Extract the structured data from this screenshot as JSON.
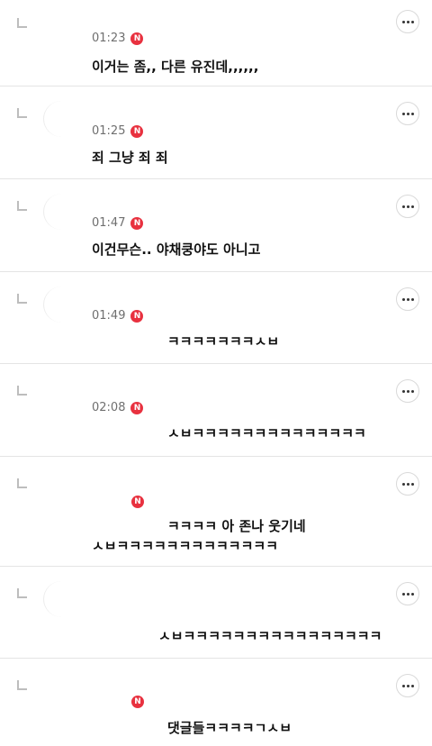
{
  "comments": [
    {
      "time": "01:23",
      "badge": "N",
      "text": "이거는 좀,, 다른 유진데,,,,,,"
    },
    {
      "time": "01:25",
      "badge": "N",
      "text": "죄 그냥 죄 죄"
    },
    {
      "time": "01:47",
      "badge": "N",
      "text": "이건무슨.. 야채쿵야도 아니고"
    },
    {
      "time": "01:49",
      "badge": "N",
      "text": "ㅋㅋㅋㅋㅋㅋㅋㅅㅂ"
    },
    {
      "time": "02:08",
      "badge": "N",
      "text": "ㅅㅂㅋㅋㅋㅋㅋㅋㅋㅋㅋㅋㅋㅋㅋㅋ"
    },
    {
      "time": "",
      "badge": "N",
      "text": "ㅋㅋㅋㅋ 아 존나 웃기네",
      "text2": "ㅅㅂㅋㅋㅋㅋㅋㅋㅋㅋㅋㅋㅋㅋㅋ"
    },
    {
      "time": "",
      "badge": "",
      "text": "ㅅㅂㅋㅋㅋㅋㅋㅋㅋㅋㅋㅋㅋㅋㅋㅋㅋㅋ"
    },
    {
      "time": "",
      "badge": "N",
      "text": "댓글들ㅋㅋㅋㅋㄱㅅㅂ"
    }
  ],
  "more_glyph": "…",
  "colors": {
    "badge": "#e8313f",
    "divider": "#e4e4e4",
    "time": "#6f6f6f"
  }
}
